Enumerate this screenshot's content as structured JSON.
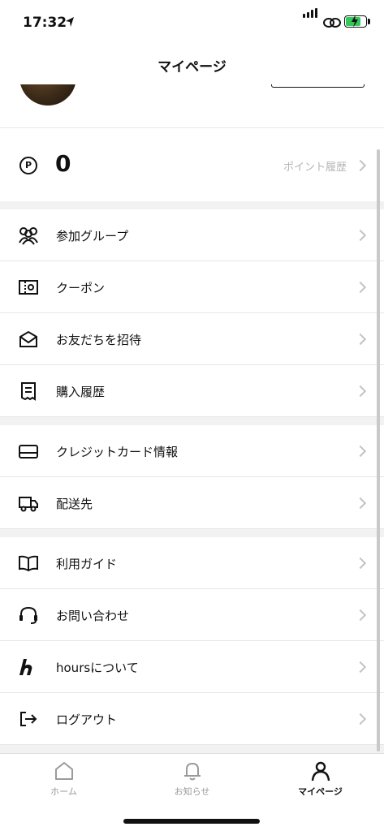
{
  "status_bar": {
    "time": "17:32"
  },
  "header": {
    "title": "マイページ"
  },
  "points": {
    "value": "0",
    "history_label": "ポイント履歴"
  },
  "menu": {
    "groups": [
      "参加グループ",
      "クーポン",
      "お友だちを招待",
      "購入履歴",
      "クレジットカード情報",
      "配送先",
      "利用ガイド",
      "お問い合わせ",
      "hoursについて",
      "ログアウト"
    ]
  },
  "icons": [
    "location-arrow-icon",
    "signal-icon",
    "link-icon",
    "battery-icon",
    "points-icon",
    "group-icon",
    "coupon-icon",
    "invite-mail-icon",
    "receipt-icon",
    "credit-card-icon",
    "truck-icon",
    "book-icon",
    "headset-icon",
    "hours-logo-icon",
    "logout-icon",
    "home-icon",
    "bell-icon",
    "person-icon",
    "chevron-right-icon"
  ],
  "tab_bar": {
    "home": "ホーム",
    "notifications": "お知らせ",
    "mypage": "マイページ"
  },
  "colors": {
    "battery": "#34c759",
    "chevron": "#c4c4c4",
    "muted_text": "#b5b5b5",
    "section_gap": "#f2f2f2"
  }
}
